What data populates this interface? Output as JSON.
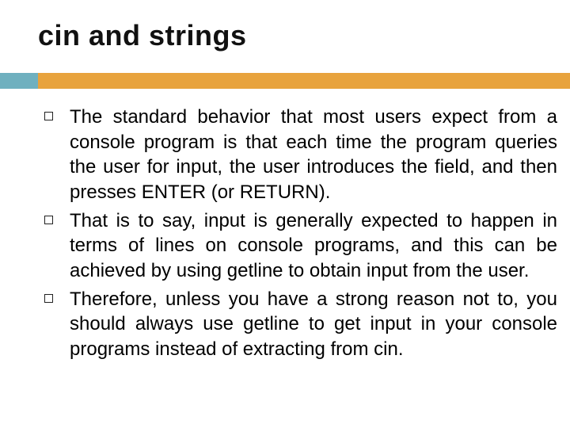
{
  "slide": {
    "title": "cin and strings",
    "bullets": [
      "The standard behavior that most users expect from a console program is that each time the program queries the user for input, the user introduces the field, and then presses ENTER (or RETURN).",
      "That is to say, input is generally expected to happen in terms of lines on console programs, and this can be achieved by using getline to obtain input from the user.",
      "Therefore, unless you have a strong reason not to, you should always use getline to get input in your console programs instead of extracting from cin."
    ]
  },
  "colors": {
    "accent_blue": "#6fb0bf",
    "accent_orange": "#e8a33d"
  }
}
